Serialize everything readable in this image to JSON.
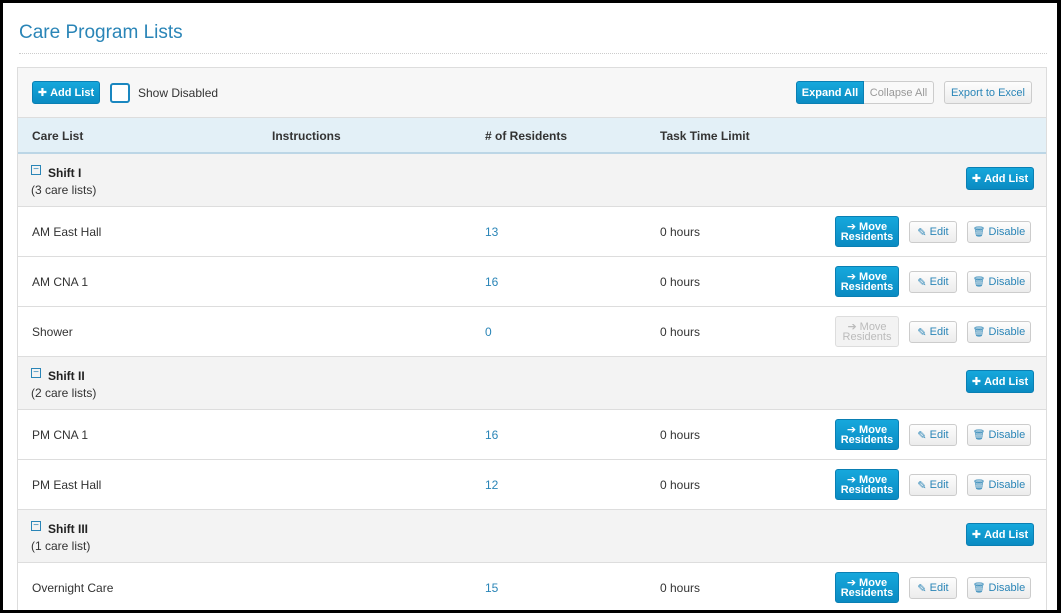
{
  "page": {
    "title": "Care Program Lists"
  },
  "toolbar": {
    "add_list_label": "Add List",
    "show_disabled_label": "Show Disabled",
    "expand_all_label": "Expand All",
    "collapse_all_label": "Collapse All",
    "export_label": "Export to Excel"
  },
  "table": {
    "columns": [
      "Care List",
      "Instructions",
      "# of Residents",
      "Task Time Limit"
    ]
  },
  "groups": [
    {
      "name": "Shift I",
      "count": "(3 care lists)",
      "add_label": "Add List",
      "rows": [
        {
          "name": "AM East Hall",
          "residents": "13",
          "time": "0 hours",
          "move_l1": "Move",
          "move_l2": "Residents",
          "edit": "Edit",
          "disable": "Disable",
          "move_enabled": true
        },
        {
          "name": "AM CNA 1",
          "residents": "16",
          "time": "0 hours",
          "move_l1": "Move",
          "move_l2": "Residents",
          "edit": "Edit",
          "disable": "Disable",
          "move_enabled": true
        },
        {
          "name": "Shower",
          "residents": "0",
          "time": "0 hours",
          "move_l1": "Move",
          "move_l2": "Residents",
          "edit": "Edit",
          "disable": "Disable",
          "move_enabled": false
        }
      ]
    },
    {
      "name": "Shift II",
      "count": "(2 care lists)",
      "add_label": "Add List",
      "rows": [
        {
          "name": "PM CNA 1",
          "residents": "16",
          "time": "0 hours",
          "move_l1": "Move",
          "move_l2": "Residents",
          "edit": "Edit",
          "disable": "Disable",
          "move_enabled": true
        },
        {
          "name": "PM East Hall",
          "residents": "12",
          "time": "0 hours",
          "move_l1": "Move",
          "move_l2": "Residents",
          "edit": "Edit",
          "disable": "Disable",
          "move_enabled": true
        }
      ]
    },
    {
      "name": "Shift III",
      "count": "(1 care list)",
      "add_label": "Add List",
      "rows": [
        {
          "name": "Overnight Care",
          "residents": "15",
          "time": "0 hours",
          "move_l1": "Move",
          "move_l2": "Residents",
          "edit": "Edit",
          "disable": "Disable",
          "move_enabled": true
        }
      ]
    }
  ],
  "icons": {
    "plus": "plus-icon",
    "arrow": "arrow-right-icon",
    "pencil": "pencil-icon",
    "trash": "trash-icon",
    "collapse": "collapse-minus-icon"
  },
  "colors": {
    "accent": "#0a8bc2",
    "title": "#2a85b7",
    "header_bg": "#e3f0f7"
  }
}
